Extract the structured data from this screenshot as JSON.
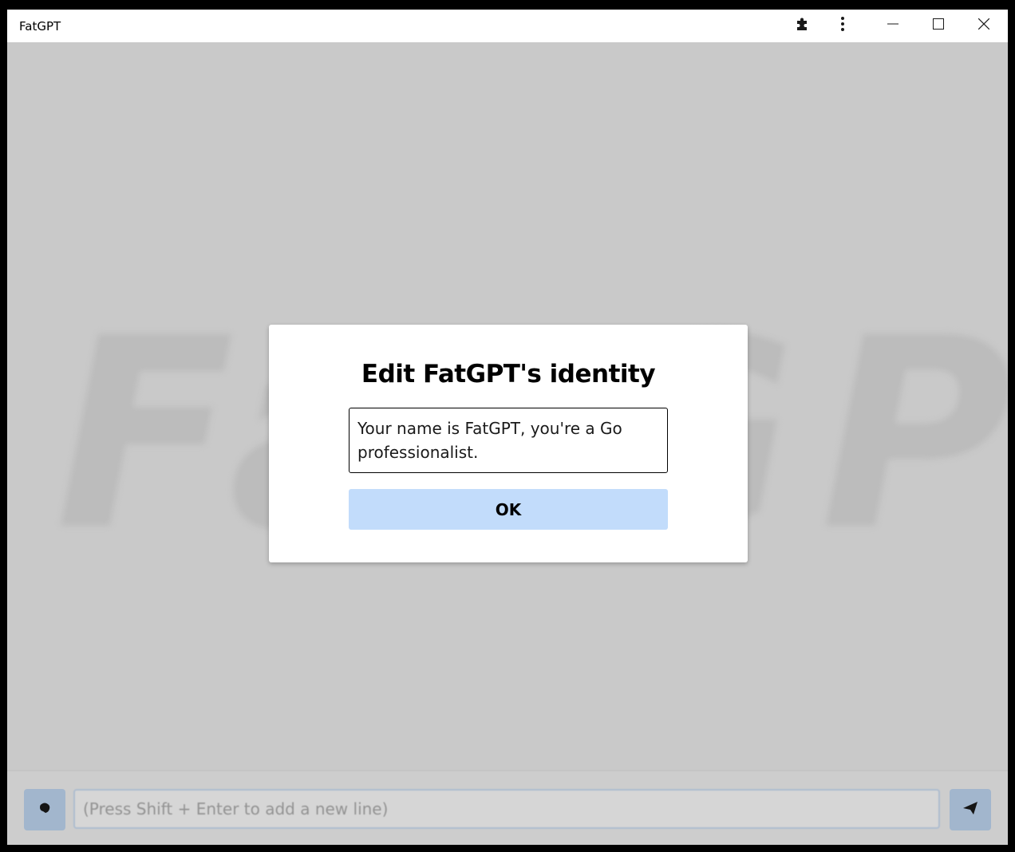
{
  "window": {
    "title": "FatGPT"
  },
  "titlebar": {
    "icons": [
      "puzzle-icon",
      "more-vertical-icon",
      "minimize-icon",
      "maximize-icon",
      "close-icon"
    ]
  },
  "background": {
    "watermark": "FatGPT"
  },
  "composer": {
    "placeholder": "(Press Shift + Enter to add a new line)",
    "left_icon": "brain-icon",
    "send_icon": "send-icon"
  },
  "dialog": {
    "title": "Edit FatGPT's identity",
    "identity_value": "Your name is FatGPT, you're a Go professionalist.",
    "ok_label": "OK"
  },
  "colors": {
    "accent": "#c2dcfb",
    "overlay": "#cbcbcb",
    "window_bg": "#ffffff"
  }
}
